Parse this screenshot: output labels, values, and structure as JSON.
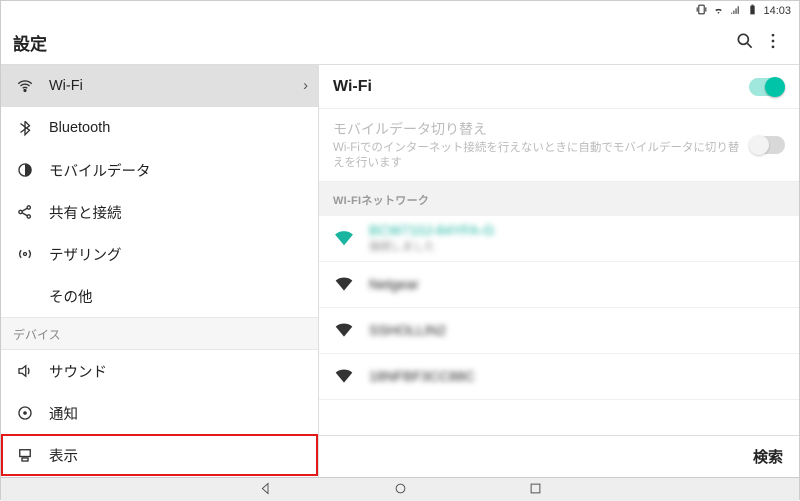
{
  "status": {
    "time": "14:03"
  },
  "header": {
    "title": "設定"
  },
  "sidebar": {
    "items": [
      {
        "label": "Wi-Fi"
      },
      {
        "label": "Bluetooth"
      },
      {
        "label": "モバイルデータ"
      },
      {
        "label": "共有と接続"
      },
      {
        "label": "テザリング"
      },
      {
        "label": "その他"
      }
    ],
    "section_device": "デバイス",
    "device_items": [
      {
        "label": "サウンド"
      },
      {
        "label": "通知"
      },
      {
        "label": "表示"
      }
    ]
  },
  "detail": {
    "title": "Wi-Fi",
    "mobile_switch": {
      "title": "モバイルデータ切り替え",
      "desc": "Wi-Fiでのインターネット接続を行えないときに自動でモバイルデータに切り替えを行います"
    },
    "networks_header": "WI-FIネットワーク",
    "networks": [
      {
        "name": "BCW710J-84YFA-G",
        "status": "接続しました",
        "connected": true
      },
      {
        "name": "Netgear",
        "status": "",
        "connected": false
      },
      {
        "name": "SSHOLLIN2",
        "status": "",
        "connected": false
      },
      {
        "name": "18NFBF3CC88C",
        "status": "",
        "connected": false
      }
    ],
    "footer_search": "検索"
  }
}
